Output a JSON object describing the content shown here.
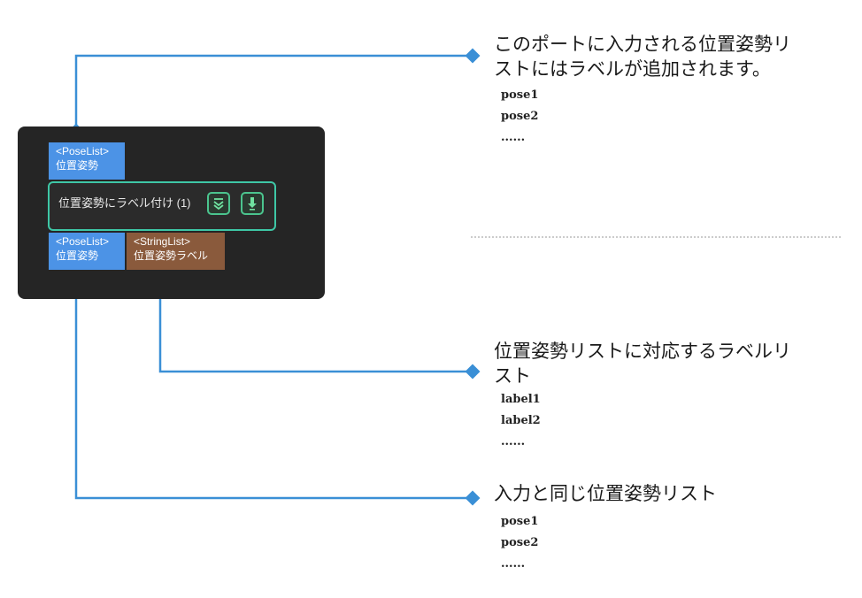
{
  "node": {
    "input_port": {
      "type": "<PoseList>",
      "name": "位置姿勢"
    },
    "step_title": "位置姿勢にラベル付け (1)",
    "buttons": [
      {
        "icon": "collapse-chevron-icon"
      },
      {
        "icon": "download-arrow-icon"
      }
    ],
    "output_ports": [
      {
        "type": "<PoseList>",
        "name": "位置姿勢"
      },
      {
        "type": "<StringList>",
        "name": "位置姿勢ラベル"
      }
    ]
  },
  "annotations": [
    {
      "title_line1": "このポートに入力される位置姿勢リ",
      "title_line2": "ストにはラベルが追加されます。",
      "items": [
        "pose1",
        "pose2",
        "......"
      ]
    },
    {
      "title_line1": "位置姿勢リストに対応するラベルリ",
      "title_line2": "スト",
      "items": [
        "label1",
        "label2",
        "......"
      ]
    },
    {
      "title_line1": "入力と同じ位置姿勢リスト",
      "items": [
        "pose1",
        "pose2",
        "......"
      ]
    }
  ],
  "colors": {
    "wire": "#3a8fd6",
    "pose_port": "#4c93e6",
    "string_port": "#8a5a3c",
    "step_border": "#3ec7a6",
    "node_bg": "#252525"
  }
}
